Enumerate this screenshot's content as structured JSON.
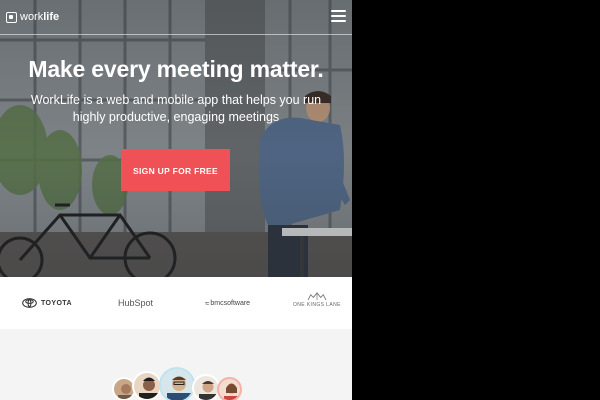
{
  "nav": {
    "logo_light": "work",
    "logo_bold": "life",
    "menu_icon": "hamburger-icon"
  },
  "hero": {
    "title": "Make every meeting matter.",
    "subtitle": "WorkLife is a web and mobile app that helps you run highly productive, engaging meetings",
    "cta_label": "SIGN UP FOR FREE"
  },
  "logos": {
    "toyota": "TOYOTA",
    "hubspot": "HubSpot",
    "bmc": "bmcsoftware",
    "okl": "ONE KINGS LANE"
  },
  "colors": {
    "cta": "#ef5157",
    "hero_text": "#ffffff",
    "page_bg": "#000000"
  }
}
